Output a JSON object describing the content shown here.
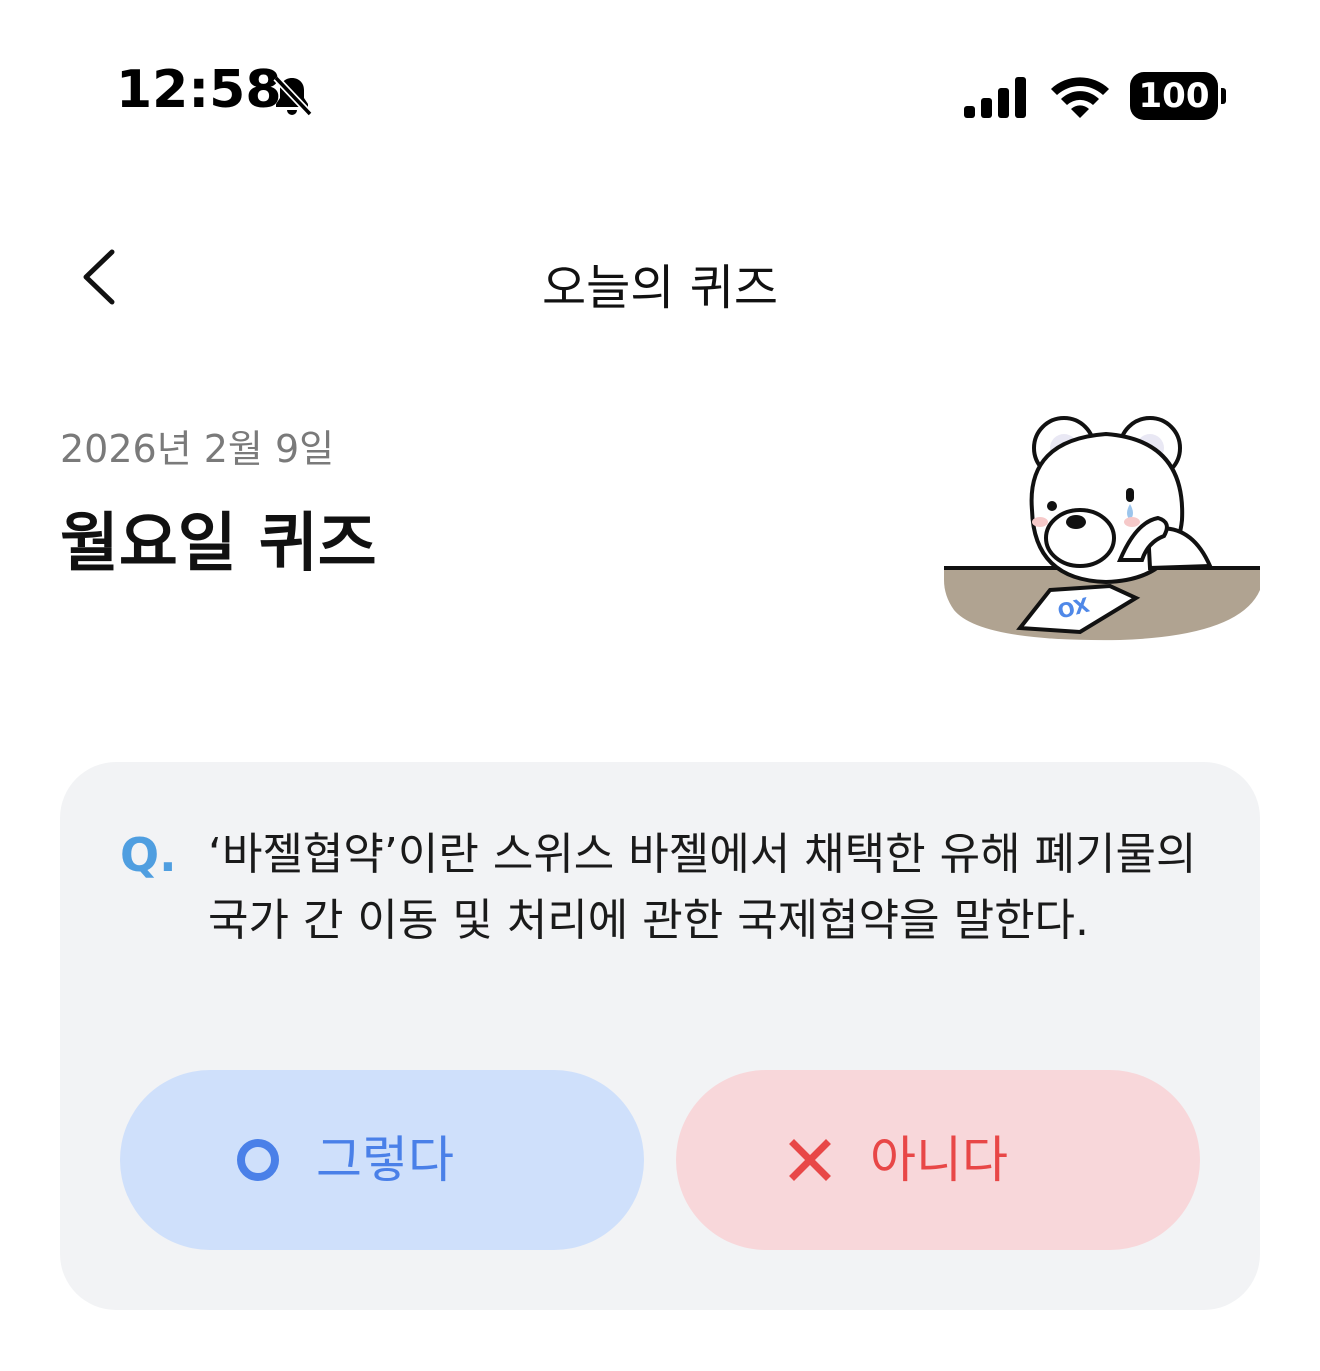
{
  "status_bar": {
    "time": "12:58",
    "battery": "100",
    "icons": [
      "bell-off-icon",
      "signal-icon",
      "wifi-icon",
      "battery-icon"
    ]
  },
  "nav": {
    "back_icon": "chevron-left-icon",
    "title": "오늘의 퀴즈"
  },
  "header": {
    "date": "2026년 2월 9일",
    "title": "월요일 퀴즈",
    "mascot": "bear-with-ox-paper-illustration",
    "mascot_paper_text": "OX"
  },
  "quiz": {
    "q_label": "Q.",
    "question_lines": [
      "‘바젤협약’이란 스위스 바젤에서 채택한 유해 폐기물의",
      "국가 간 이동 및 처리에 관한 국제협약을 말한다."
    ],
    "options": [
      {
        "icon": "circle-o-icon",
        "label": "그렇다",
        "color": "#4a80e8",
        "bg": "#cfe0fb"
      },
      {
        "icon": "x-mark-icon",
        "label": "아니다",
        "color": "#e84747",
        "bg": "#f8d7da"
      }
    ]
  },
  "colors": {
    "q_accent": "#4f9ee0",
    "card_bg": "#f2f3f5",
    "date_text": "#7a7a7a"
  }
}
